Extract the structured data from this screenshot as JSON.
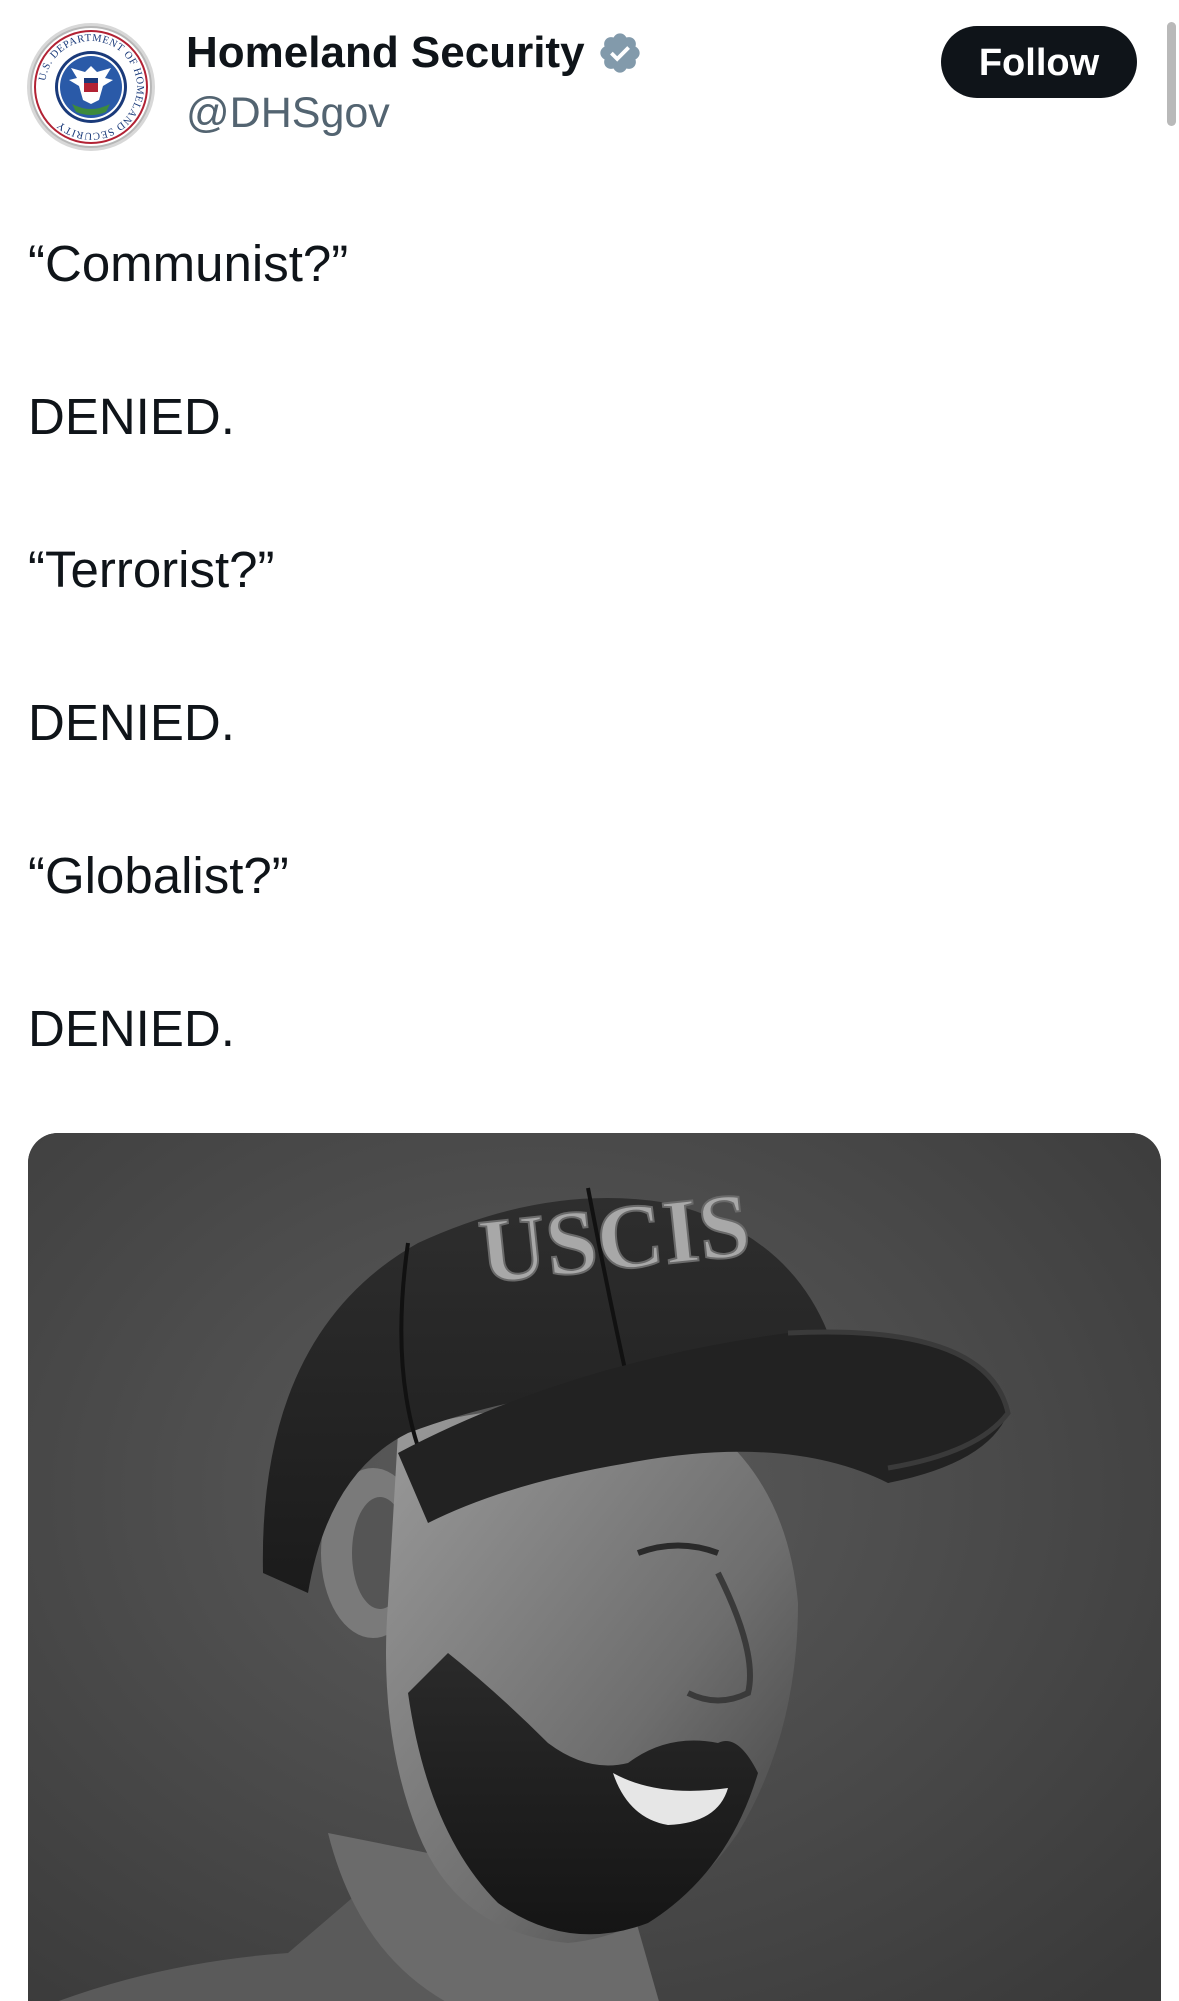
{
  "account": {
    "display_name": "Homeland Security",
    "handle": "@DHSgov",
    "verified_icon": "verified-badge-icon",
    "avatar_icon": "dhs-seal-icon",
    "avatar_seal_text": "U.S. DEPARTMENT OF HOMELAND SECURITY"
  },
  "header": {
    "follow_label": "Follow"
  },
  "tweet": {
    "lines": [
      "“Communist?”",
      "DENIED.",
      "“Terrorist?”",
      "DENIED.",
      "“Globalist?”",
      "DENIED."
    ]
  },
  "media": {
    "cap_text": "USCIS"
  },
  "colors": {
    "text": "#0f1419",
    "secondary_text": "#536471",
    "follow_bg": "#0f1419",
    "verified_badge": "#829aab",
    "seal_blue": "#1a3a7a",
    "seal_red": "#b22234"
  }
}
